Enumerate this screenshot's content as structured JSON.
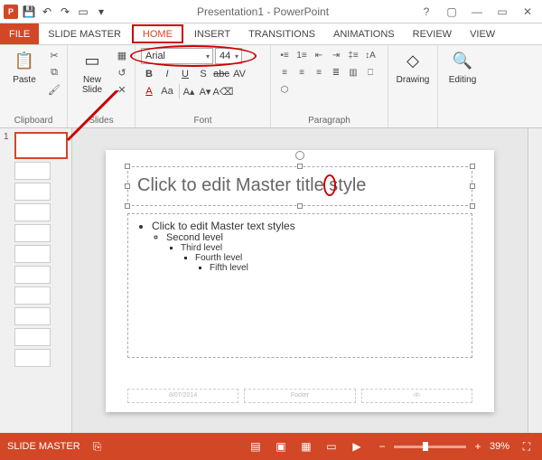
{
  "titlebar": {
    "title": "Presentation1 - PowerPoint"
  },
  "tabs": {
    "file": "FILE",
    "slidemaster": "SLIDE MASTER",
    "home": "HOME",
    "insert": "INSERT",
    "transitions": "TRANSITIONS",
    "animations": "ANIMATIONS",
    "review": "REVIEW",
    "view": "VIEW"
  },
  "ribbon": {
    "clipboard": {
      "paste": "Paste",
      "label": "Clipboard"
    },
    "slides": {
      "newslide": "New\nSlide",
      "label": "Slides"
    },
    "font": {
      "name": "Arial",
      "size": "44",
      "label": "Font"
    },
    "paragraph": {
      "label": "Paragraph"
    },
    "drawing": {
      "drawing": "Drawing",
      "label": "Drawing"
    },
    "editing": {
      "editing": "Editing",
      "label": "Editing"
    }
  },
  "thumbnails": {
    "num1": "1"
  },
  "slide": {
    "title_placeholder": "Click to edit Master title style",
    "body_l1": "Click to edit Master text styles",
    "body_l2": "Second level",
    "body_l3": "Third level",
    "body_l4": "Fourth level",
    "body_l5": "Fifth level",
    "footer_date": "8/07/2014",
    "footer_center": "Footer",
    "footer_num": "‹#›"
  },
  "status": {
    "mode": "SLIDE MASTER",
    "zoom": "39%"
  }
}
